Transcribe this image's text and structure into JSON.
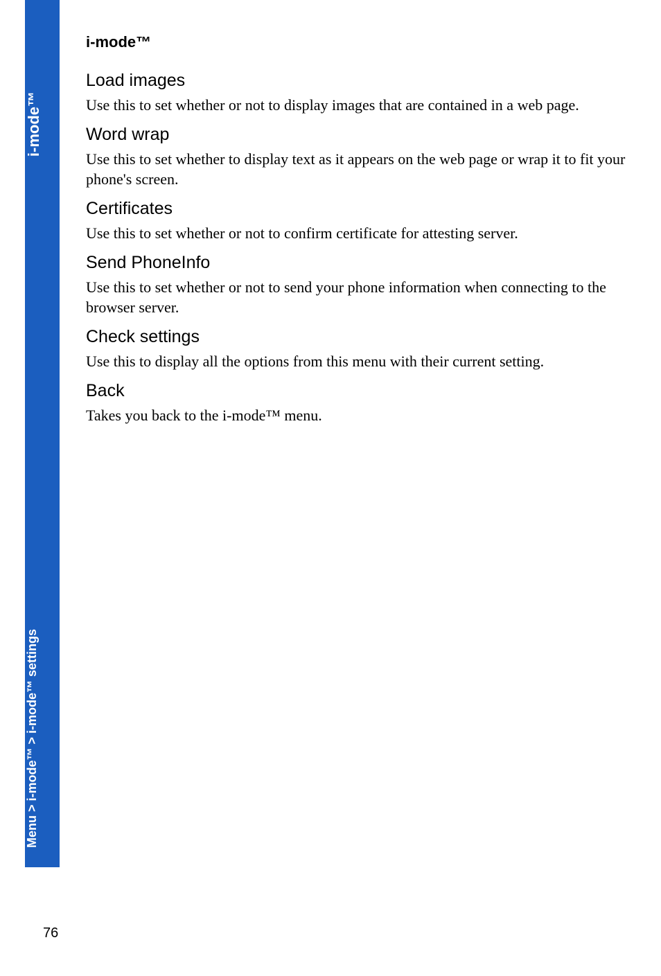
{
  "sidebar": {
    "top_label": "i-mode™",
    "bottom_label": "Menu > i-mode™ > i-mode™ settings"
  },
  "chapter_title": "i-mode™",
  "sections": {
    "load_images": {
      "heading": "Load images",
      "body": "Use this to set whether or not to display images that are contained in a web page."
    },
    "word_wrap": {
      "heading": "Word wrap",
      "body": "Use this to set whether to display text as it appears on the web page or wrap it to fit your phone's screen."
    },
    "certificates": {
      "heading": "Certificates",
      "body": "Use this to set whether or not to confirm certificate for attesting server."
    },
    "send_phoneinfo": {
      "heading": "Send PhoneInfo",
      "body": "Use this to set whether or not to send your phone information when connecting to the browser server."
    },
    "check_settings": {
      "heading": "Check settings",
      "body": "Use this to display all the options from this menu with their current setting."
    },
    "back": {
      "heading": "Back",
      "body": "Takes you back to the i-mode™ menu."
    }
  },
  "page_number": "76"
}
